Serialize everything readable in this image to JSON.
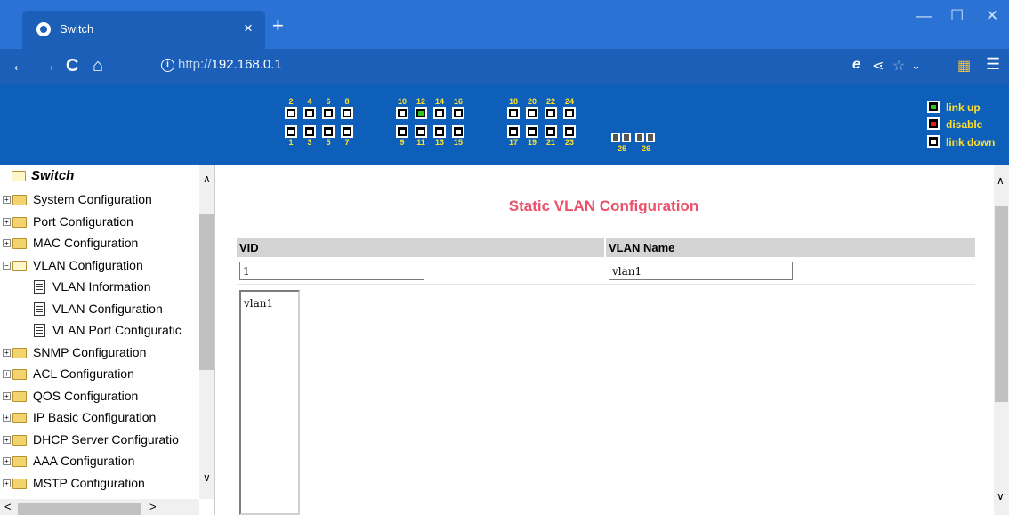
{
  "browser": {
    "tab_title": "Switch",
    "tab_close": "×",
    "new_tab": "+",
    "window_controls": [
      "—",
      "☐",
      "✕"
    ],
    "nav": {
      "back": "←",
      "forward": "→",
      "reload": "C",
      "home": "⌂"
    },
    "url_protocol": "http://",
    "url_host": "192.168.0.1",
    "toolbar_icons": [
      "e",
      "share-icon",
      "star-icon",
      "chevron-down-icon",
      "extensions-icon",
      "menu-icon"
    ]
  },
  "panel": {
    "top_ports": [
      "2",
      "4",
      "6",
      "8",
      "10",
      "12",
      "14",
      "16",
      "18",
      "20",
      "22",
      "24"
    ],
    "bottom_ports": [
      "1",
      "3",
      "5",
      "7",
      "9",
      "11",
      "13",
      "15",
      "17",
      "19",
      "21",
      "23"
    ],
    "sfp_ports": [
      "25",
      "26"
    ],
    "link_up_port": "12",
    "legend": {
      "up": "link up",
      "disable": "disable",
      "down": "link down"
    },
    "colors": {
      "up": "#2dc71f",
      "disable": "#e51d1d",
      "down": "#ffffff",
      "label": "#ffe12d",
      "background": "#0e5fba"
    }
  },
  "sidebar": {
    "root": "Switch",
    "items": [
      {
        "label": "System Configuration",
        "type": "folder",
        "expanded": false
      },
      {
        "label": "Port Configuration",
        "type": "folder",
        "expanded": false
      },
      {
        "label": "MAC Configuration",
        "type": "folder",
        "expanded": false
      },
      {
        "label": "VLAN Configuration",
        "type": "folder",
        "expanded": true
      },
      {
        "label": "VLAN Information",
        "type": "page"
      },
      {
        "label": "VLAN Configuration",
        "type": "page"
      },
      {
        "label": "VLAN Port Configuratic",
        "type": "page"
      },
      {
        "label": "SNMP Configuration",
        "type": "folder",
        "expanded": false
      },
      {
        "label": "ACL Configuration",
        "type": "folder",
        "expanded": false
      },
      {
        "label": "QOS Configuration",
        "type": "folder",
        "expanded": false
      },
      {
        "label": "IP Basic Configuration",
        "type": "folder",
        "expanded": false
      },
      {
        "label": "DHCP Server Configuratio",
        "type": "folder",
        "expanded": false
      },
      {
        "label": "AAA Configuration",
        "type": "folder",
        "expanded": false
      },
      {
        "label": "MSTP Configuration",
        "type": "folder",
        "expanded": false
      }
    ]
  },
  "main": {
    "title": "Static VLAN Configuration",
    "vid_header": "VID",
    "name_header": "VLAN Name",
    "vid_value": "1",
    "name_value": "vlan1",
    "vlan_list": [
      "vlan1"
    ]
  }
}
